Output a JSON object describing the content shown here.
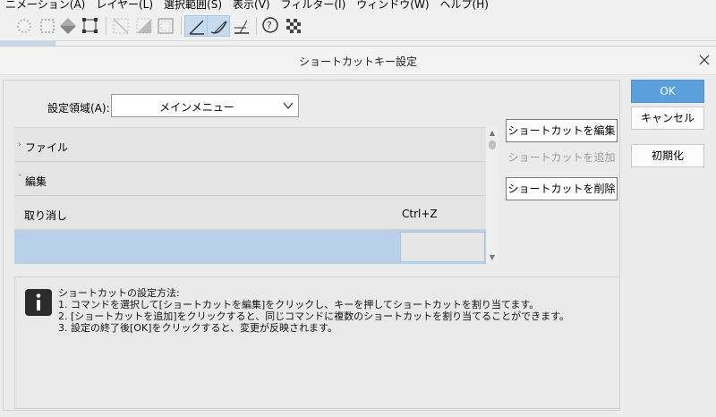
{
  "menubar": {
    "items": [
      "ニメーション(A)",
      "レイヤー(L)",
      "選択範囲(S)",
      "表示(V)",
      "フィルター(I)",
      "ウィンドウ(W)",
      "ヘルプ(H)"
    ]
  },
  "toolbar": {
    "icons": [
      "selection-dots-icon",
      "selection-dashed-icon",
      "selection-shape-icon",
      "transform-handles-icon",
      "grid-off-icon",
      "grid-gradient-icon",
      "frame-icon",
      "ruler-snap-icon",
      "curve-ruler-icon",
      "perspective-ruler-icon",
      "help-cursor-icon",
      "checker-icon"
    ]
  },
  "dialog": {
    "title": "ショートカットキー設定",
    "scope_label": "設定領域(A):",
    "scope_value": "メインメニュー",
    "tree": {
      "rows": [
        {
          "type": "group",
          "caret": "›",
          "label": "ファイル"
        },
        {
          "type": "group",
          "caret": "ˇ",
          "label": "編集"
        },
        {
          "type": "command",
          "label": "取り消し",
          "shortcut": "Ctrl+Z"
        },
        {
          "type": "selected",
          "label": "",
          "shortcut": ""
        }
      ]
    },
    "buttons": {
      "edit_shortcut": "ショートカットを編集",
      "add_shortcut": "ショートカットを追加",
      "delete_shortcut": "ショートカットを削除",
      "ok": "OK",
      "cancel": "キャンセル",
      "reset": "初期化"
    },
    "help": {
      "lines": [
        "ショートカットの設定方法:",
        "1. コマンドを選択して[ショートカットを編集]をクリックし、キーを押してショートカットを割り当てます。",
        "2. [ショートカットを追加]をクリックすると、同じコマンドに複数のショートカットを割り当てることができます。",
        "3. 設定の終了後[OK]をクリックすると、変更が反映されます。"
      ]
    }
  },
  "colors": {
    "accent": "#5aa0dc",
    "selection": "#b8d1e8",
    "panel": "#ececec"
  }
}
